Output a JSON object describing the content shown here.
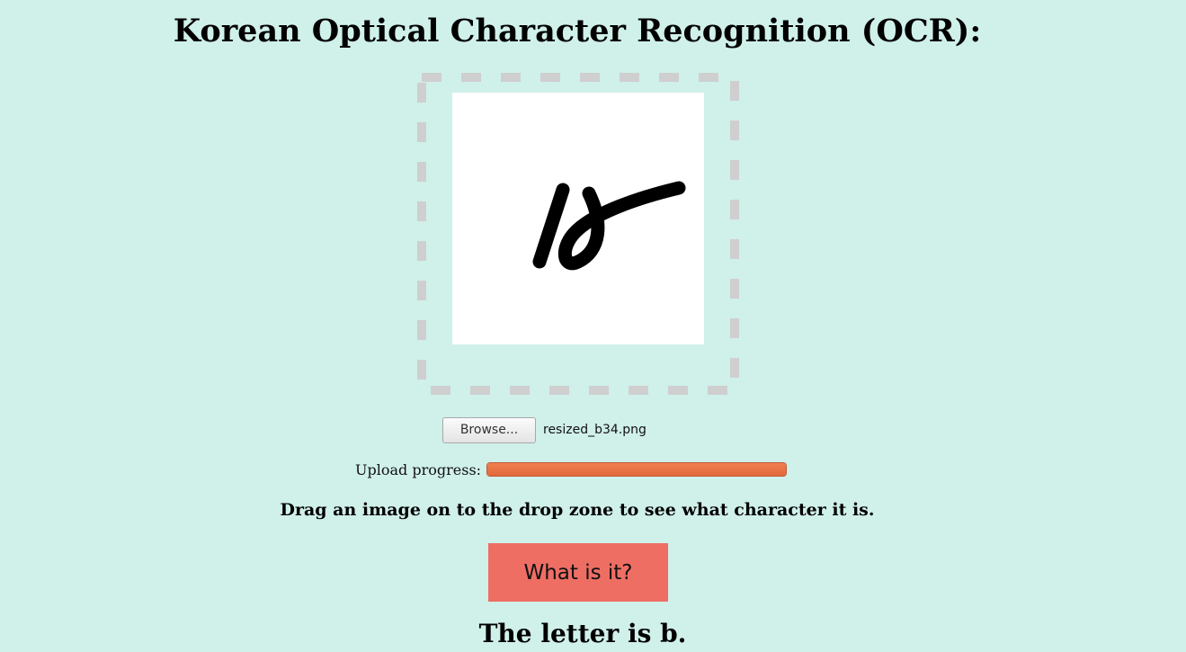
{
  "page": {
    "title": "Korean Optical Character Recognition (OCR):"
  },
  "drop_zone": {
    "preview_image": "handwritten-korean-character"
  },
  "file_input": {
    "browse_label": "Browse...",
    "file_name": "resized_b34.png"
  },
  "upload": {
    "label": "Upload progress:",
    "progress": 1.0
  },
  "instructions": "Drag an image on to the drop zone to see what character it is.",
  "action_button": {
    "label": "What is it?"
  },
  "result": {
    "text": "The letter is b."
  },
  "colors": {
    "background": "#d0f0ea",
    "dashed_border": "#cfcfcf",
    "progress_fill": "#e8704a",
    "button": "#ee6e64"
  }
}
